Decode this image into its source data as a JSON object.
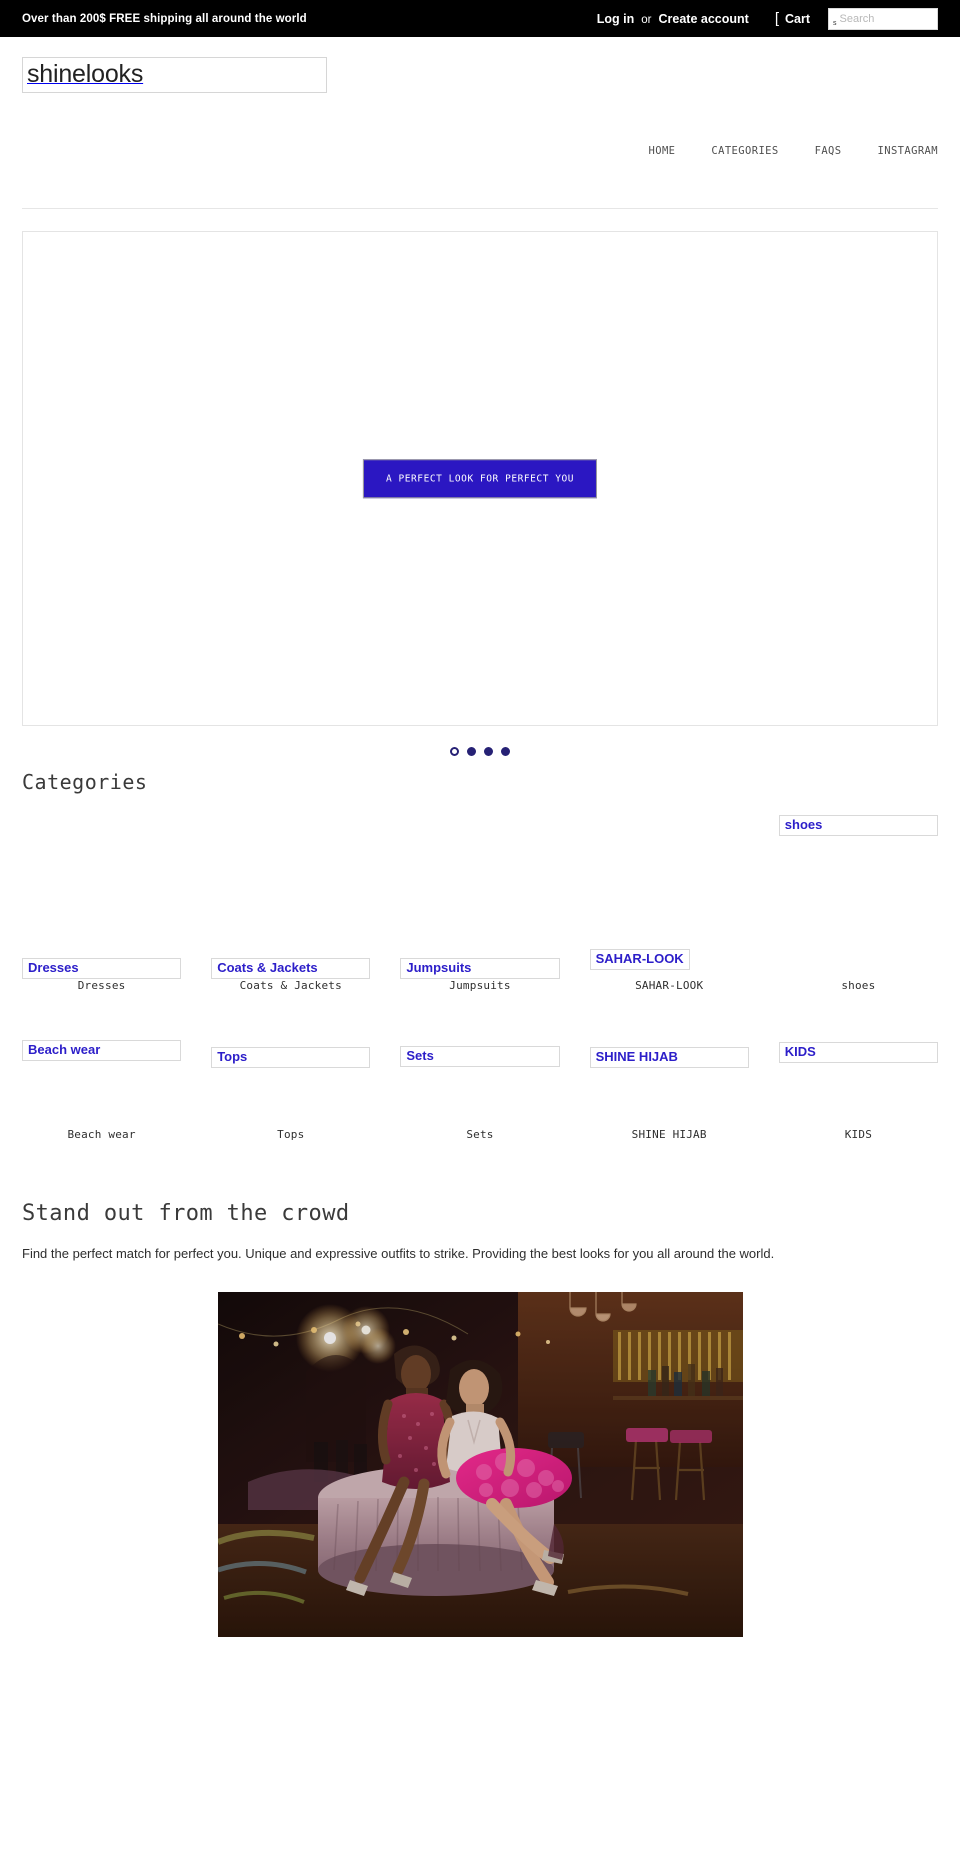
{
  "topbar": {
    "announcement": "Over than 200$ FREE shipping all around the world",
    "login_label": "Log in",
    "or_label": "or",
    "create_account_label": "Create account",
    "cart_bracket": "[",
    "cart_label": "Cart",
    "search_icon_alt": "s",
    "search_placeholder": "Search",
    "search_value": ""
  },
  "header": {
    "logo_text": "shinelooks",
    "nav": [
      {
        "label": "HOME"
      },
      {
        "label": "CATEGORIES"
      },
      {
        "label": "FAQS"
      },
      {
        "label": "INSTAGRAM"
      }
    ]
  },
  "hero": {
    "cta_label": "A PERFECT LOOK FOR PERFECT YOU",
    "cta_color": "#2b17c2",
    "dots": [
      {
        "active": true
      },
      {
        "active": false
      },
      {
        "active": false
      },
      {
        "active": false
      }
    ]
  },
  "categories": {
    "title": "Categories",
    "row1": [
      {
        "alt": "Dresses",
        "label": "Dresses"
      },
      {
        "alt": "Coats & Jackets",
        "label": "Coats & Jackets"
      },
      {
        "alt": "Jumpsuits",
        "label": "Jumpsuits"
      },
      {
        "alt": "SAHAR-LOOK",
        "label": "SAHAR-LOOK"
      },
      {
        "alt": "shoes",
        "label": "shoes"
      }
    ],
    "row2": [
      {
        "alt": "Beach wear",
        "label": "Beach wear"
      },
      {
        "alt": "Tops",
        "label": "Tops"
      },
      {
        "alt": "Sets",
        "label": "Sets"
      },
      {
        "alt": "SHINE HIJAB",
        "label": "SHINE HIJAB"
      },
      {
        "alt": "KIDS",
        "label": "KIDS"
      }
    ],
    "link_color": "#2c1ec9"
  },
  "standout": {
    "title": "Stand out from the crowd",
    "body": "Find the perfect match for perfect you. Unique and expressive outfits to strike. Providing the best looks for you all around the world."
  },
  "feature_photo": {
    "alt": "Two women in evening dresses seated on a pink velvet ottoman in a dimly lit nightclub bar"
  }
}
